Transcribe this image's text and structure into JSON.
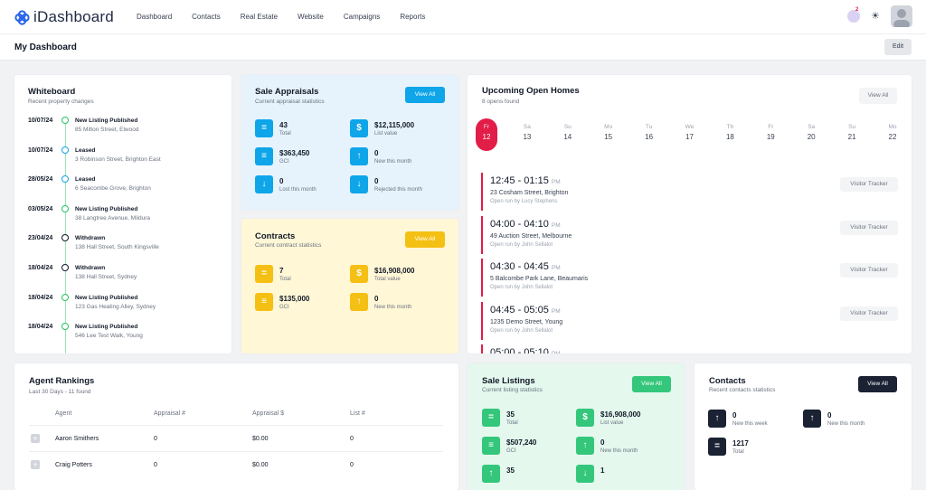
{
  "app": {
    "brand": "iDashboard"
  },
  "nav": [
    "Dashboard",
    "Contacts",
    "Real Estate",
    "Website",
    "Campaigns",
    "Reports"
  ],
  "header": {
    "notification_count": "2",
    "page_title": "My Dashboard",
    "edit_label": "Edit"
  },
  "whiteboard": {
    "title": "Whiteboard",
    "subtitle": "Recent property changes",
    "items": [
      {
        "date": "10/07/24",
        "title": "New Listing Published",
        "address": "85 Milton Street, Elwood",
        "color": "#22c55e"
      },
      {
        "date": "10/07/24",
        "title": "Leased",
        "address": "3 Robinson Street, Brighton East",
        "color": "#0ea5e9"
      },
      {
        "date": "28/05/24",
        "title": "Leased",
        "address": "6 Seacombe Grove, Brighton",
        "color": "#0ea5e9"
      },
      {
        "date": "03/05/24",
        "title": "New Listing Published",
        "address": "38 Langtree Avenue, Mildura",
        "color": "#22c55e"
      },
      {
        "date": "23/04/24",
        "title": "Withdrawn",
        "address": "138 Hall Street, South Kingsville",
        "color": "#111827"
      },
      {
        "date": "18/04/24",
        "title": "Withdrawn",
        "address": "138 Hall Street, Sydney",
        "color": "#111827"
      },
      {
        "date": "18/04/24",
        "title": "New Listing Published",
        "address": "123 Gas Heating Alley, Sydney",
        "color": "#22c55e"
      },
      {
        "date": "18/04/24",
        "title": "New Listing Published",
        "address": "546 Lee Test Walk, Young",
        "color": "#22c55e"
      }
    ]
  },
  "sale_appraisals": {
    "title": "Sale Appraisals",
    "subtitle": "Current appraisal statistics",
    "button": "View All",
    "stats": [
      {
        "value": "43",
        "label": "Total",
        "icon": "equals-icon",
        "glyph": "="
      },
      {
        "value": "$12,115,000",
        "label": "List value",
        "icon": "dollar-icon",
        "glyph": "$"
      },
      {
        "value": "$363,450",
        "label": "GCI",
        "icon": "money-stack-icon",
        "glyph": "≡"
      },
      {
        "value": "0",
        "label": "New this month",
        "icon": "arrow-up-icon",
        "glyph": "↑"
      },
      {
        "value": "0",
        "label": "Lost this month",
        "icon": "arrow-down-icon",
        "glyph": "↓"
      },
      {
        "value": "0",
        "label": "Rejected this month",
        "icon": "arrow-down-icon",
        "glyph": "↓"
      }
    ]
  },
  "contracts": {
    "title": "Contracts",
    "subtitle": "Current contract statistics",
    "button": "View All",
    "stats": [
      {
        "value": "7",
        "label": "Total",
        "icon": "equals-icon",
        "glyph": "="
      },
      {
        "value": "$16,908,000",
        "label": "Total value",
        "icon": "dollar-icon",
        "glyph": "$"
      },
      {
        "value": "$135,000",
        "label": "GCI",
        "icon": "money-stack-icon",
        "glyph": "≡"
      },
      {
        "value": "0",
        "label": "New this month",
        "icon": "arrow-up-icon",
        "glyph": "↑"
      }
    ]
  },
  "open_homes": {
    "title": "Upcoming Open Homes",
    "subtitle": "8 opens found",
    "button": "View All",
    "days": [
      {
        "dow": "Fr",
        "num": "12",
        "active": true
      },
      {
        "dow": "Sa",
        "num": "13"
      },
      {
        "dow": "Su",
        "num": "14"
      },
      {
        "dow": "Mo",
        "num": "15"
      },
      {
        "dow": "Tu",
        "num": "16"
      },
      {
        "dow": "We",
        "num": "17"
      },
      {
        "dow": "Th",
        "num": "18"
      },
      {
        "dow": "Fr",
        "num": "19"
      },
      {
        "dow": "Sa",
        "num": "20"
      },
      {
        "dow": "Su",
        "num": "21"
      },
      {
        "dow": "Mo",
        "num": "22"
      }
    ],
    "items": [
      {
        "time": "12:45 - 01:15",
        "ampm": "PM",
        "address": "23 Cosham Street, Brighton",
        "by": "Open run by Lucy Stephens",
        "button": "Visitor Tracker"
      },
      {
        "time": "04:00 - 04:10",
        "ampm": "PM",
        "address": "49 Auction Street, Melbourne",
        "by": "Open run by John Sellalot",
        "button": "Visitor Tracker"
      },
      {
        "time": "04:30 - 04:45",
        "ampm": "PM",
        "address": "5 Balcombe Park Lane, Beaumaris",
        "by": "Open run by John Sellalot",
        "button": "Visitor Tracker"
      },
      {
        "time": "04:45 - 05:05",
        "ampm": "PM",
        "address": "1235 Demo Street, Young",
        "by": "Open run by John Sellalot",
        "button": "Visitor Tracker"
      },
      {
        "time": "05:00 - 05:10",
        "ampm": "PM",
        "address": "",
        "by": "",
        "button": ""
      }
    ]
  },
  "agent_rankings": {
    "title": "Agent Rankings",
    "subtitle": "Last 30 Days - 11 found",
    "columns": [
      "Agent",
      "Appraisal #",
      "Appraisal $",
      "List #"
    ],
    "rows": [
      [
        "Aaron Smithers",
        "0",
        "$0.00",
        "0"
      ],
      [
        "Craig Potters",
        "0",
        "$0.00",
        "0"
      ]
    ]
  },
  "sale_listings": {
    "title": "Sale Listings",
    "subtitle": "Current listing statistics",
    "button": "View All",
    "stats": [
      {
        "value": "35",
        "label": "Total",
        "icon": "equals-icon",
        "glyph": "="
      },
      {
        "value": "$16,908,000",
        "label": "List value",
        "icon": "dollar-icon",
        "glyph": "$"
      },
      {
        "value": "$507,240",
        "label": "GCI",
        "icon": "money-stack-icon",
        "glyph": "≡"
      },
      {
        "value": "0",
        "label": "New this month",
        "icon": "arrow-up-icon",
        "glyph": "↑"
      },
      {
        "value": "35",
        "label": "",
        "icon": "arrow-up-icon",
        "glyph": "↑"
      },
      {
        "value": "1",
        "label": "",
        "icon": "arrow-down-icon",
        "glyph": "↓"
      }
    ]
  },
  "contacts": {
    "title": "Contacts",
    "subtitle": "Recent contacts statistics",
    "button": "View All",
    "stats": [
      {
        "value": "0",
        "label": "New this week",
        "icon": "arrow-up-icon",
        "glyph": "↑"
      },
      {
        "value": "0",
        "label": "New this month",
        "icon": "arrow-up-icon",
        "glyph": "↑"
      },
      {
        "value": "1217",
        "label": "Total",
        "icon": "equals-icon",
        "glyph": "="
      }
    ]
  },
  "colors": {
    "blue": "#0ea5e9",
    "amber": "#f5c014",
    "green": "#34c77b",
    "navy": "#1a2233",
    "red": "#e11d48"
  }
}
